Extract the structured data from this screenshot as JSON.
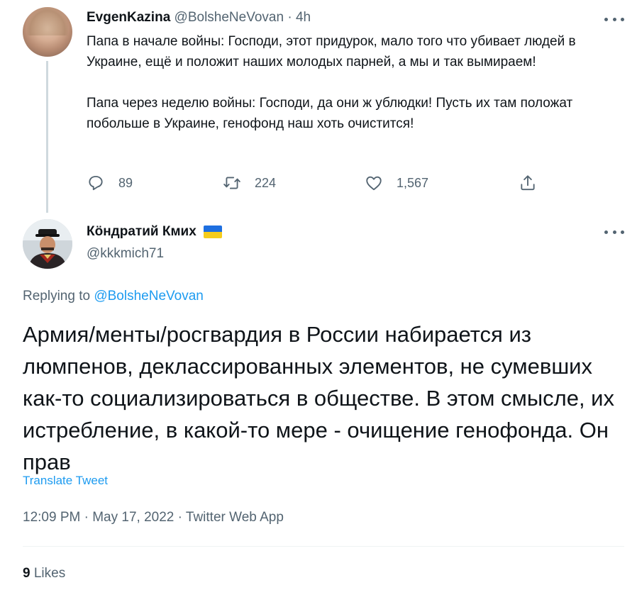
{
  "parent_tweet": {
    "author_name": "EvgenKazina",
    "author_handle": "@BolsheNeVovan",
    "separator": "·",
    "time": "4h",
    "text": "Папа в начале войны: Господи, этот придурок, мало того что убивает людей в Украине, ещё и положит наших молодых парней, а мы и так вымираем!\n\nПапа через неделю войны: Господи, да они ж ублюдки! Пусть их там положат побольше в Украине, генофонд наш хоть очистится!",
    "replies": "89",
    "retweets": "224",
    "likes": "1,567",
    "icons": {
      "reply": "reply-icon",
      "retweet": "retweet-icon",
      "like": "heart-icon",
      "share": "share-icon",
      "more": "more-icon"
    }
  },
  "main_tweet": {
    "author_name": "Кöндратий Кмих",
    "author_handle": "@kkkmich71",
    "flag_colors": {
      "top": "#1e6fe0",
      "bottom": "#f5cc1c"
    },
    "replying_prefix": "Replying to",
    "replying_handle": "@BolsheNeVovan",
    "text": "Армия/менты/росгвардия в России набирается из люмпенов, деклассированных элементов, не сумевших как-то социализироваться в обществе. В этом смысле, их истребление, в какой-то мере - очищение генофонда. Он прав",
    "translate_label": "Translate Tweet",
    "timestamp": "12:09 PM",
    "separator": "·",
    "date": "May 17, 2022",
    "source": "Twitter Web App",
    "likes_count": "9",
    "likes_label": "Likes"
  },
  "colors": {
    "text_primary": "#0f1419",
    "text_secondary": "#536471",
    "link": "#1d9bf0",
    "thread_line": "#cfd9de"
  }
}
